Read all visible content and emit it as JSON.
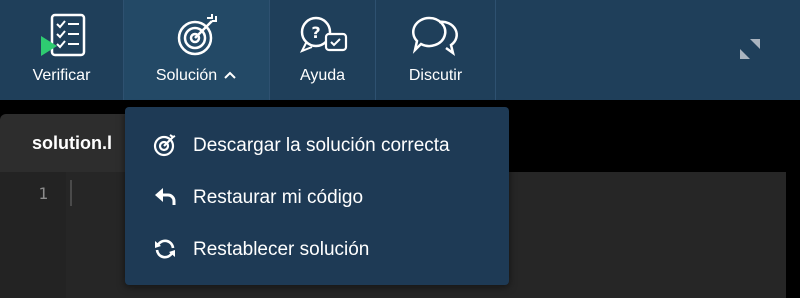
{
  "toolbar": {
    "buttons": [
      {
        "label": "Verificar",
        "icon": "checklist-play-icon"
      },
      {
        "label": "Solución",
        "icon": "target-icon"
      },
      {
        "label": "Ayuda",
        "icon": "question-chat-icon"
      },
      {
        "label": "Discutir",
        "icon": "chat-bubbles-icon"
      }
    ],
    "expand_icon": "expand-icon"
  },
  "editor": {
    "tab_label": "solution.l",
    "line_numbers": [
      "1"
    ]
  },
  "dropdown": {
    "items": [
      {
        "label": "Descargar la solución correcta",
        "icon": "target-check-icon"
      },
      {
        "label": "Restaurar mi código",
        "icon": "undo-arrow-icon"
      },
      {
        "label": "Restablecer solución",
        "icon": "refresh-icon"
      }
    ]
  },
  "colors": {
    "toolbar_bg": "#1f3f5a",
    "dropdown_bg": "#1e3a55",
    "play_accent": "#2ecc71",
    "editor_bg": "#262626"
  }
}
